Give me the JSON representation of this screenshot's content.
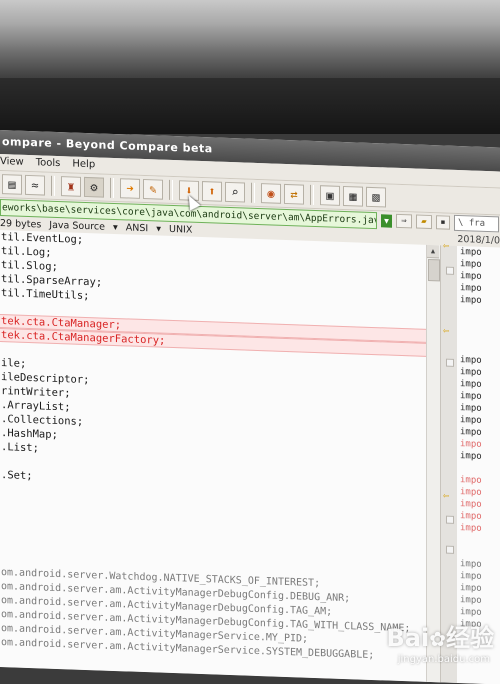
{
  "window": {
    "title": "ompare - Beyond Compare beta"
  },
  "menu": [
    "View",
    "Tools",
    "Help"
  ],
  "toolbar": {
    "buttons": [
      "copy-icon",
      "equals-icon",
      "rules-icon",
      "session-icon",
      "next-arrow-icon",
      "edit-icon",
      "prev-diff-icon",
      "next-diff-icon",
      "find-icon",
      "swap-icon",
      "refresh-icon",
      "merge-icon",
      "options-icon",
      "save-icon"
    ]
  },
  "path": {
    "left": "eworks\\base\\services\\core\\java\\com\\android\\server\\am\\AppErrors.java",
    "right": "\\ fra"
  },
  "info": {
    "size": "29 bytes",
    "format": "Java Source",
    "encoding": "ANSI",
    "line_endings": "UNIX",
    "right_date": "2018/1/0"
  },
  "left_lines": [
    {
      "text": "til.EventLog;",
      "kind": "normal"
    },
    {
      "text": "til.Log;",
      "kind": "normal"
    },
    {
      "text": "til.Slog;",
      "kind": "normal"
    },
    {
      "text": "til.SparseArray;",
      "kind": "normal"
    },
    {
      "text": "til.TimeUtils;",
      "kind": "normal"
    },
    {
      "text": "",
      "kind": "normal"
    },
    {
      "text": "tek.cta.CtaManager;",
      "kind": "diff"
    },
    {
      "text": "tek.cta.CtaManagerFactory;",
      "kind": "diff"
    },
    {
      "text": "",
      "kind": "normal"
    },
    {
      "text": "ile;",
      "kind": "normal"
    },
    {
      "text": "ileDescriptor;",
      "kind": "normal"
    },
    {
      "text": "rintWriter;",
      "kind": "normal"
    },
    {
      "text": ".ArrayList;",
      "kind": "normal"
    },
    {
      "text": ".Collections;",
      "kind": "normal"
    },
    {
      "text": ".HashMap;",
      "kind": "normal"
    },
    {
      "text": ".List;",
      "kind": "normal"
    },
    {
      "text": "",
      "kind": "normal"
    },
    {
      "text": ".Set;",
      "kind": "normal"
    },
    {
      "text": "",
      "kind": "normal"
    },
    {
      "text": "",
      "kind": "normal"
    },
    {
      "text": "",
      "kind": "normal"
    },
    {
      "text": "",
      "kind": "normal"
    },
    {
      "text": "",
      "kind": "normal"
    },
    {
      "text": "",
      "kind": "normal"
    },
    {
      "text": "om.android.server.Watchdog.NATIVE_STACKS_OF_INTEREST;",
      "kind": "faint"
    },
    {
      "text": "om.android.server.am.ActivityManagerDebugConfig.DEBUG_ANR;",
      "kind": "faint"
    },
    {
      "text": "om.android.server.am.ActivityManagerDebugConfig.TAG_AM;",
      "kind": "faint"
    },
    {
      "text": "om.android.server.am.ActivityManagerDebugConfig.TAG_WITH_CLASS_NAME;",
      "kind": "faint"
    },
    {
      "text": "om.android.server.am.ActivityManagerService.MY_PID;",
      "kind": "faint"
    },
    {
      "text": "om.android.server.am.ActivityManagerService.SYSTEM_DEBUGGABLE;",
      "kind": "faint"
    }
  ],
  "right_lines": [
    {
      "text": "impo",
      "kind": "normal"
    },
    {
      "text": "impo",
      "kind": "normal"
    },
    {
      "text": "impo",
      "kind": "normal"
    },
    {
      "text": "impo",
      "kind": "normal"
    },
    {
      "text": "impo",
      "kind": "normal"
    },
    {
      "text": "",
      "kind": "normal"
    },
    {
      "text": "",
      "kind": "normal"
    },
    {
      "text": "",
      "kind": "normal"
    },
    {
      "text": "",
      "kind": "normal"
    },
    {
      "text": "impo",
      "kind": "normal"
    },
    {
      "text": "impo",
      "kind": "normal"
    },
    {
      "text": "impo",
      "kind": "normal"
    },
    {
      "text": "impo",
      "kind": "normal"
    },
    {
      "text": "impo",
      "kind": "normal"
    },
    {
      "text": "impo",
      "kind": "normal"
    },
    {
      "text": "impo",
      "kind": "normal"
    },
    {
      "text": "impo",
      "kind": "diff"
    },
    {
      "text": "impo",
      "kind": "normal"
    },
    {
      "text": "",
      "kind": "normal"
    },
    {
      "text": "impo",
      "kind": "diff"
    },
    {
      "text": "impo",
      "kind": "diff"
    },
    {
      "text": "impo",
      "kind": "diff"
    },
    {
      "text": "impo",
      "kind": "diff"
    },
    {
      "text": "impo",
      "kind": "diff"
    },
    {
      "text": "",
      "kind": "normal"
    },
    {
      "text": "",
      "kind": "normal"
    },
    {
      "text": "impo",
      "kind": "gray"
    },
    {
      "text": "impo",
      "kind": "gray"
    },
    {
      "text": "impo",
      "kind": "gray"
    },
    {
      "text": "impo",
      "kind": "gray"
    },
    {
      "text": "impo",
      "kind": "gray"
    },
    {
      "text": "impo",
      "kind": "gray"
    }
  ],
  "watermark": {
    "brand": "Bai",
    "brand_suffix": "经验",
    "url": "jingyan.baidu.com"
  },
  "colors": {
    "path_bg": "#e6f7d9",
    "diff_text": "#d82323",
    "diff_bg": "#fde6e6"
  }
}
